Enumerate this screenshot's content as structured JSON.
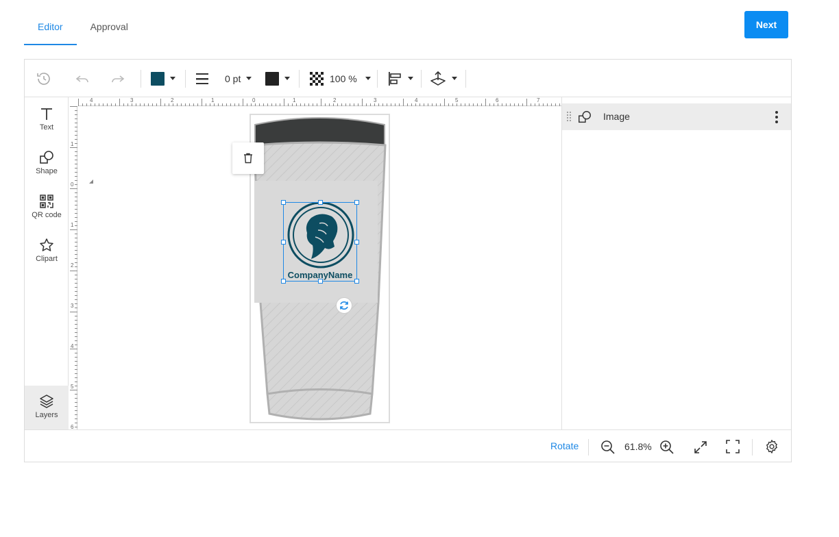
{
  "tabs": [
    {
      "label": "Editor",
      "active": true
    },
    {
      "label": "Approval",
      "active": false
    }
  ],
  "next_label": "Next",
  "toolbar": {
    "fill_color": "#0d4d61",
    "stroke_width": "0 pt",
    "stroke_color": "#222222",
    "opacity": "100 %"
  },
  "sidebar": {
    "items": [
      {
        "label": "Text",
        "icon": "text-icon"
      },
      {
        "label": "Shape",
        "icon": "shape-icon"
      },
      {
        "label": "QR code",
        "icon": "qr-code-icon"
      },
      {
        "label": "Clipart",
        "icon": "star-icon"
      }
    ],
    "layers_label": "Layers"
  },
  "canvas": {
    "logo_text": "CompanyName",
    "ruler_top": [
      "4",
      "3",
      "2",
      "1",
      "0",
      "1",
      "2",
      "3",
      "4",
      "5",
      "6",
      "7"
    ],
    "ruler_left": [
      "1",
      "0",
      "1",
      "2",
      "3",
      "4",
      "5",
      "6"
    ]
  },
  "layers_panel": {
    "items": [
      {
        "label": "Image",
        "icon": "shape-icon"
      }
    ]
  },
  "bottom_bar": {
    "rotate_label": "Rotate",
    "zoom": "61.8%"
  },
  "colors": {
    "accent": "#1e88e5",
    "button": "#0b8cf2",
    "logo": "#0d4d61"
  }
}
